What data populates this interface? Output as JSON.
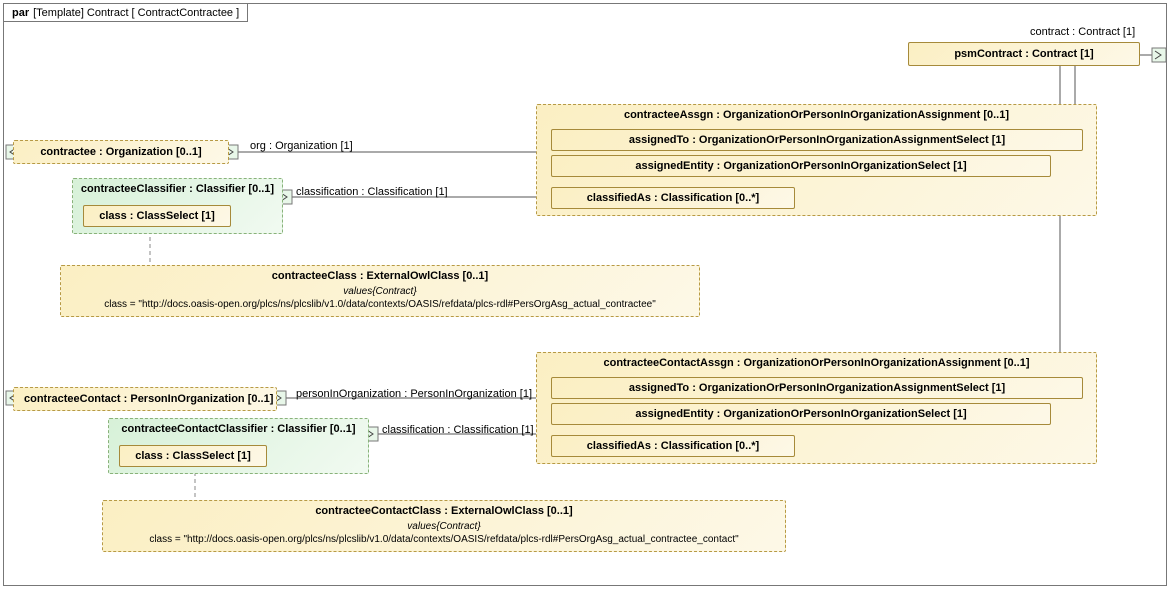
{
  "frame": {
    "kind": "par",
    "template": "[Template] Contract [ ContractContractee ]"
  },
  "edges": {
    "contract": "contract : Contract [1]",
    "org": "org : Organization [1]",
    "classification1": "classification : Classification [1]",
    "personInOrg": "personInOrganization : PersonInOrganization [1]",
    "classification2": "classification : Classification [1]"
  },
  "nodes": {
    "psmContract": "psmContract : Contract [1]",
    "contractee": "contractee : Organization [0..1]",
    "contracteeContact": "contracteeContact : PersonInOrganization [0..1]"
  },
  "classifiers": {
    "contracteeClassifier": {
      "title": "contracteeClassifier : Classifier [0..1]",
      "classSelect": "class : ClassSelect [1]"
    },
    "contracteeContactClassifier": {
      "title": "contracteeContactClassifier : Classifier [0..1]",
      "classSelect": "class : ClassSelect [1]"
    }
  },
  "assignments": {
    "contracteeAssgn": {
      "title": "contracteeAssgn : OrganizationOrPersonInOrganizationAssignment [0..1]",
      "assignedTo": "assignedTo : OrganizationOrPersonInOrganizationAssignmentSelect [1]",
      "assignedEntity": "assignedEntity : OrganizationOrPersonInOrganizationSelect [1]",
      "classifiedAs": "classifiedAs : Classification [0..*]"
    },
    "contracteeContactAssgn": {
      "title": "contracteeContactAssgn : OrganizationOrPersonInOrganizationAssignment [0..1]",
      "assignedTo": "assignedTo : OrganizationOrPersonInOrganizationAssignmentSelect [1]",
      "assignedEntity": "assignedEntity : OrganizationOrPersonInOrganizationSelect [1]",
      "classifiedAs": "classifiedAs : Classification [0..*]"
    }
  },
  "externals": {
    "contracteeClass": {
      "title": "contracteeClass : ExternalOwlClass [0..1]",
      "subtitle": "values{Contract}",
      "body": "class = \"http://docs.oasis-open.org/plcs/ns/plcslib/v1.0/data/contexts/OASIS/refdata/plcs-rdl#PersOrgAsg_actual_contractee\""
    },
    "contracteeContactClass": {
      "title": "contracteeContactClass : ExternalOwlClass [0..1]",
      "subtitle": "values{Contract}",
      "body": "class = \"http://docs.oasis-open.org/plcs/ns/plcslib/v1.0/data/contexts/OASIS/refdata/plcs-rdl#PersOrgAsg_actual_contractee_contact\""
    }
  }
}
